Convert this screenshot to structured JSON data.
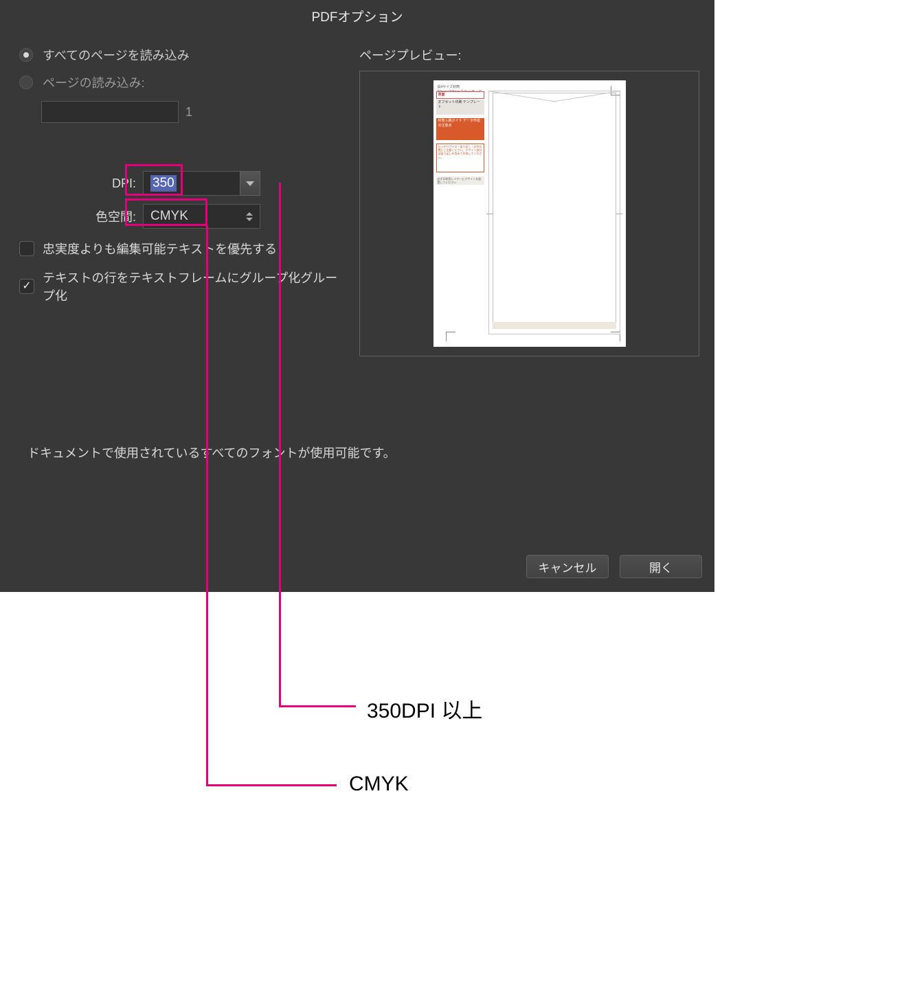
{
  "dialogTitle": "PDFオプション",
  "radioAllPages": "すべてのページを読み込み",
  "radioPageRange": "ページの読み込み:",
  "pageCount": "1",
  "dpiLabel": "DPI:",
  "dpiValue": "350",
  "colorSpaceLabel": "色空間:",
  "colorSpaceValue": "CMYK",
  "checkbox1": "忠実度よりも編集可能テキストを優先する",
  "checkbox2": "テキストの行をテキストフレームにグループ化グループ化",
  "previewLabel": "ページプレビュー:",
  "fontStatus": "ドキュメントで使用されているすべてのフォントが使用可能です。",
  "cancelButton": "キャンセル",
  "openButton": "開く",
  "annoDpi": "350DPI 以上",
  "annoCs": "CMYK",
  "preview": {
    "meta": "長4サイズ封筒",
    "sub": "90mm×205mmカラー/モノクロ",
    "tag": "表面",
    "title": "オフセット印刷\nテンプレート",
    "orange": "封筒入稿ガイド\nデータ作成の注意点",
    "outline": "仕上がりサイズ・塗り足し・文字位置にご注意ください。デザイン部分は塗り足しを含めて作成してください。",
    "gray": "必ず印刷用レイヤーにデザインを配置してください"
  }
}
